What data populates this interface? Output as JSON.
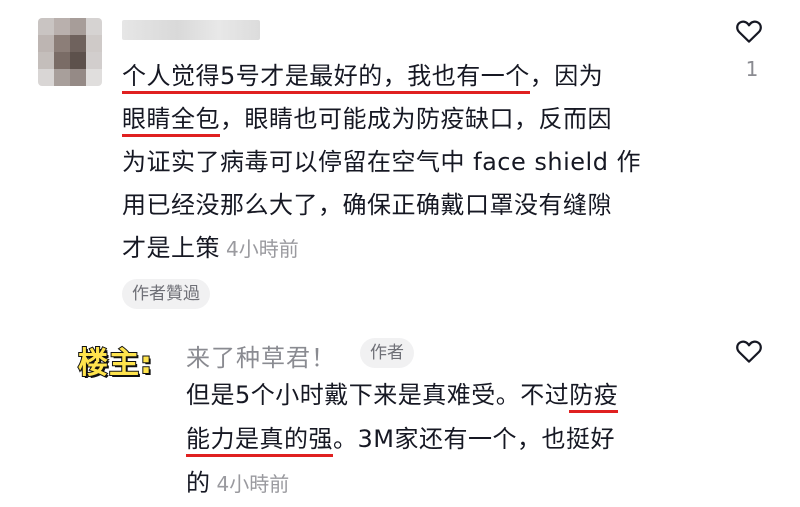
{
  "comment": {
    "line1": "个人觉得5号才是最好的，我也有一个",
    "line1_tail": "，因为",
    "line2_hl": "眼睛全包",
    "line2_tail": "，眼睛也可能成为防疫缺口，反而因",
    "line3": "为证实了病毒可以停留在空气中 face shield 作",
    "line4": "用已经没那么大了，确保正确戴口罩没有缝隙",
    "line5": "才是上策",
    "time": "4小時前",
    "like_count": "1",
    "creator_liked": "作者贊過"
  },
  "reply": {
    "op_label": "楼主:",
    "author": "来了种草君！",
    "author_badge": "作者",
    "line1_a": "但是5个小时戴下来是真难受。不过",
    "line1_hl": "防疫",
    "line2_hl": "能力是真的强",
    "line2_tail": "。3M家还有一个，也挺好",
    "line3": "的",
    "time": "4小時前"
  },
  "colors": {
    "highlight_underline": "#e02020",
    "op_badge_fill": "#ffe44d",
    "muted_text": "#8a8b91"
  },
  "icons": {
    "like": "heart-outline-icon"
  }
}
